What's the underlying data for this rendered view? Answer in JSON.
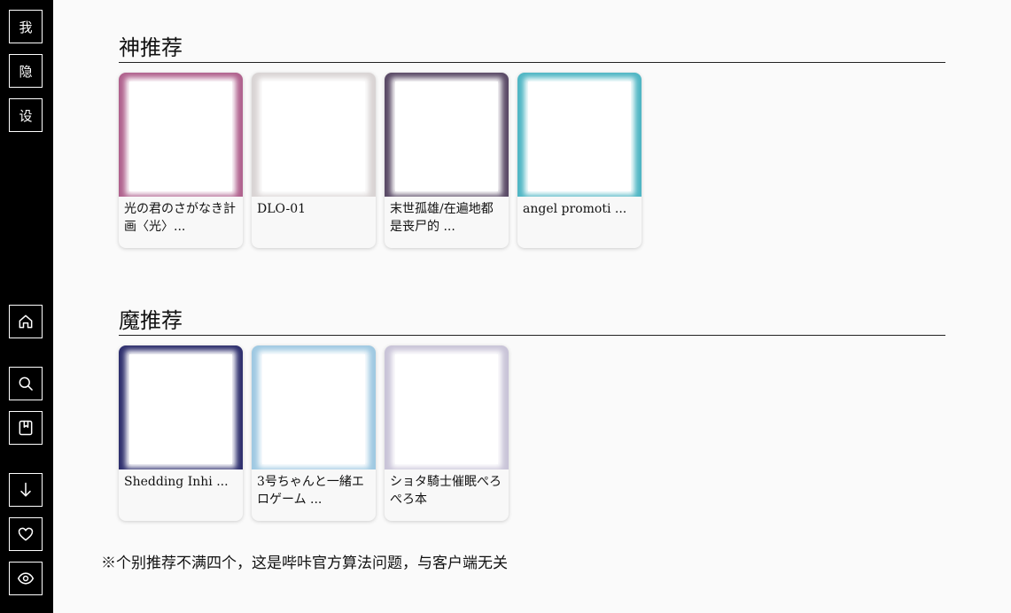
{
  "sidebar": {
    "top_buttons": [
      "我",
      "隐",
      "设"
    ],
    "icons": [
      "home-icon",
      "search-icon",
      "bookmark-icon",
      "download-arrow-icon",
      "heart-icon",
      "eye-icon"
    ]
  },
  "sections": [
    {
      "title": "神推荐",
      "cards": [
        {
          "title": "光の君のさがなき計画〈光〉...",
          "cover_color": "#b0628e"
        },
        {
          "title": "DLO-01",
          "cover_color": "#d9d4d4"
        },
        {
          "title": "末世孤雄/在遍地都是丧尸的 ...",
          "cover_color": "#5a4a66"
        },
        {
          "title": "angel promoti ...",
          "cover_color": "#4fb6c4"
        }
      ]
    },
    {
      "title": "魔推荐",
      "cards": [
        {
          "title": "Shedding Inhi ...",
          "cover_color": "#2e2f6e"
        },
        {
          "title": "3号ちゃんと一緒エロゲーム ...",
          "cover_color": "#9fc9e2"
        },
        {
          "title": "ショタ騎士催眠ぺろぺろ本",
          "cover_color": "#c9c4d8"
        }
      ]
    }
  ],
  "footnote": "※个别推荐不满四个，这是哔咔官方算法问题，与客户端无关"
}
